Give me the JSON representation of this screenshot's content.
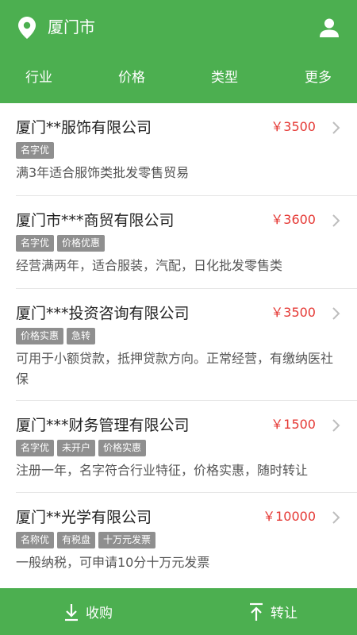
{
  "header": {
    "city": "厦门市",
    "filters": [
      "行业",
      "价格",
      "类型",
      "更多"
    ]
  },
  "colors": {
    "primary_green": "#4caf50",
    "price_red": "#e53935",
    "tag_gray": "#8f8f8f"
  },
  "icons": {
    "location": "map-pin-icon",
    "user": "person-icon",
    "chevron": "chevron-right-icon",
    "purchase": "download-arrow-icon",
    "transfer": "upload-arrow-icon"
  },
  "listings": [
    {
      "title": "厦门**服饰有限公司",
      "price": "￥3500",
      "tags": [
        "名字优"
      ],
      "desc": "满3年适合服饰类批发零售贸易"
    },
    {
      "title": "厦门市***商贸有限公司",
      "price": "￥3600",
      "tags": [
        "名字优",
        "价格优惠"
      ],
      "desc": "经营满两年，适合服装，汽配，日化批发零售类"
    },
    {
      "title": "厦门***投资咨询有限公司",
      "price": "￥3500",
      "tags": [
        "价格实惠",
        "急转"
      ],
      "desc": "可用于小额贷款，抵押贷款方向。正常经营，有缴纳医社保"
    },
    {
      "title": "厦门***财务管理有限公司",
      "price": "￥1500",
      "tags": [
        "名字优",
        "未开户",
        "价格实惠"
      ],
      "desc": "注册一年，名字符合行业特征，价格实惠，随时转让"
    },
    {
      "title": "厦门**光学有限公司",
      "price": "￥10000",
      "tags": [
        "名称优",
        "有税盘",
        "十万元发票"
      ],
      "desc": "一般纳税，可申请10分十万元发票"
    }
  ],
  "bottom": {
    "purchase_label": "收购",
    "transfer_label": "转让"
  }
}
